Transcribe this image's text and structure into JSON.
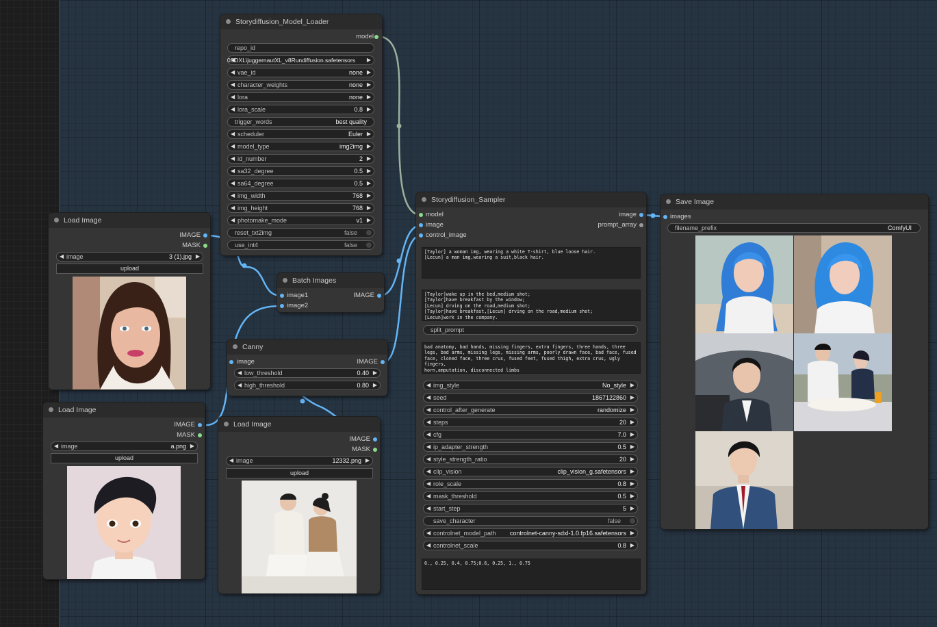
{
  "model_loader": {
    "title": "Storydiffusion_Model_Loader",
    "output": "model",
    "repo_id": "repo_id",
    "ckpt_name": "0SDXL\\juggernautXL_v8Rundiffusion.safetensors",
    "widgets": [
      {
        "label": "vae_id",
        "value": "none"
      },
      {
        "label": "character_weights",
        "value": "none"
      },
      {
        "label": "lora",
        "value": "none"
      },
      {
        "label": "lora_scale",
        "value": "0.8"
      }
    ],
    "trigger_words": {
      "label": "trigger_words",
      "value": "best quality"
    },
    "widgets2": [
      {
        "label": "scheduler",
        "value": "Euler"
      },
      {
        "label": "model_type",
        "value": "img2img"
      },
      {
        "label": "id_number",
        "value": "2"
      },
      {
        "label": "sa32_degree",
        "value": "0.5"
      },
      {
        "label": "sa64_degree",
        "value": "0.5"
      },
      {
        "label": "img_width",
        "value": "768"
      },
      {
        "label": "img_height",
        "value": "768"
      },
      {
        "label": "photomake_mode",
        "value": "v1"
      }
    ],
    "toggles": [
      {
        "label": "reset_txt2img",
        "value": "false"
      },
      {
        "label": "use_int4",
        "value": "false"
      }
    ]
  },
  "load_image_1": {
    "title": "Load Image",
    "outputs": [
      "IMAGE",
      "MASK"
    ],
    "image_label": "image",
    "image_value": "3 (1).jpg",
    "upload": "upload"
  },
  "load_image_2": {
    "title": "Load Image",
    "outputs": [
      "IMAGE",
      "MASK"
    ],
    "image_label": "image",
    "image_value": "a.png",
    "upload": "upload"
  },
  "load_image_3": {
    "title": "Load Image",
    "outputs": [
      "IMAGE",
      "MASK"
    ],
    "image_label": "image",
    "image_value": "12332.png",
    "upload": "upload"
  },
  "batch_images": {
    "title": "Batch Images",
    "inputs": [
      "image1",
      "image2"
    ],
    "output": "IMAGE"
  },
  "canny": {
    "title": "Canny",
    "input": "image",
    "output": "IMAGE",
    "widgets": [
      {
        "label": "low_threshold",
        "value": "0.40"
      },
      {
        "label": "high_threshold",
        "value": "0.80"
      }
    ]
  },
  "sampler": {
    "title": "Storydiffusion_Sampler",
    "inputs": [
      "model",
      "image",
      "control_image"
    ],
    "outputs": [
      "image",
      "prompt_array"
    ],
    "character_prompt": "[Taylor] a woman img, wearing a white T-shirt, blue loose hair.\n[Lecun] a man img,wearing a suit,black hair.",
    "scene_prompts": "[Taylor]wake up in the bed,medium shot;\n[Taylor]have breakfast by the window;\n[Lecun] drving on the road,medium shot;\n[Taylor]have breakfast,[Lecun] drving on the road,medium shot;\n[Lecun]work in the company.",
    "split_prompt": "split_prompt",
    "negative_prompt": "bad anatomy, bad hands, missing fingers, extra fingers, three hands, three legs, bad arms, missing legs, missing arms, poorly drawn face, bad face, fused face, cloned face, three crus, fused feet, fused thigh, extra crus, ugly fingers,\nhorn,amputation, disconnected limbs",
    "widgets": [
      {
        "label": "img_style",
        "value": "No_style"
      },
      {
        "label": "seed",
        "value": "1867122860"
      },
      {
        "label": "control_after_generate",
        "value": "randomize"
      },
      {
        "label": "steps",
        "value": "20"
      },
      {
        "label": "cfg",
        "value": "7.0"
      },
      {
        "label": "ip_adapter_strength",
        "value": "0.5"
      },
      {
        "label": "style_strength_ratio",
        "value": "20"
      },
      {
        "label": "clip_vision",
        "value": "clip_vision_g.safetensors"
      },
      {
        "label": "role_scale",
        "value": "0.8"
      },
      {
        "label": "mask_threshold",
        "value": "0.5"
      },
      {
        "label": "start_step",
        "value": "5"
      }
    ],
    "save_character": {
      "label": "save_character",
      "value": "false"
    },
    "widgets2": [
      {
        "label": "controlnet_model_path",
        "value": "controlnet-canny-sdxl-1.0.fp16.safetensors"
      },
      {
        "label": "controlnet_scale",
        "value": "0.8"
      }
    ],
    "layout_text": "0., 0.25, 0.4, 0.75;0.6, 0.25, 1., 0.75"
  },
  "save_image": {
    "title": "Save Image",
    "input": "images",
    "filename_label": "filename_prefix",
    "filename_value": "ComfyUI"
  },
  "colors": {
    "image_link": "#64b5f6",
    "model_link": "#b4c8b4",
    "node_bg": "#353535",
    "canvas": "#263442"
  }
}
